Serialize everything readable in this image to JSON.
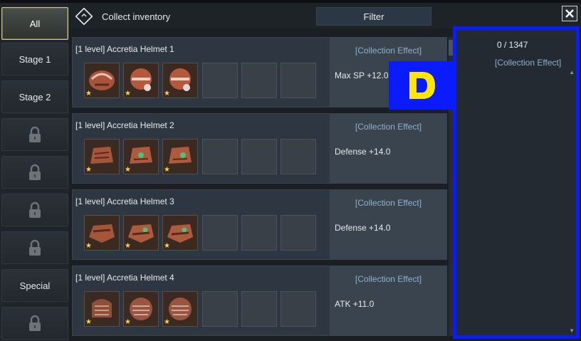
{
  "header": {
    "title": "Collect inventory",
    "filter_label": "Filter"
  },
  "sidebar": {
    "items": [
      {
        "label": "All",
        "active": true,
        "locked": false
      },
      {
        "label": "Stage 1",
        "active": false,
        "locked": false
      },
      {
        "label": "Stage 2",
        "active": false,
        "locked": false
      },
      {
        "label": "",
        "active": false,
        "locked": true
      },
      {
        "label": "",
        "active": false,
        "locked": true
      },
      {
        "label": "",
        "active": false,
        "locked": true
      },
      {
        "label": "",
        "active": false,
        "locked": true
      },
      {
        "label": "Special",
        "active": false,
        "locked": false
      },
      {
        "label": "",
        "active": false,
        "locked": true
      }
    ]
  },
  "collections": [
    {
      "title": "[1 level] Accretia Helmet 1",
      "effect_header": "[Collection Effect]",
      "effect": "Max SP +12.0",
      "filled_slots": 3,
      "total_slots": 6
    },
    {
      "title": "[1 level] Accretia Helmet 2",
      "effect_header": "[Collection Effect]",
      "effect": "Defense +14.0",
      "filled_slots": 3,
      "total_slots": 6
    },
    {
      "title": "[1 level] Accretia Helmet 3",
      "effect_header": "[Collection Effect]",
      "effect": "Defense +14.0",
      "filled_slots": 3,
      "total_slots": 6
    },
    {
      "title": "[1 level] Accretia Helmet 4",
      "effect_header": "[Collection Effect]",
      "effect": "ATK +11.0",
      "filled_slots": 3,
      "total_slots": 6
    }
  ],
  "right_panel": {
    "count": "0 / 1347",
    "effect_header": "[Collection Effect]"
  },
  "badge": {
    "letter": "D"
  },
  "colors": {
    "accent_blue": "#0b1bff",
    "badge_letter": "#ffe600",
    "effect_header": "#8fb0cf",
    "star": "#f3d35b"
  },
  "icons": {
    "logo": "diamond-logo-icon",
    "close": "close-icon",
    "lock": "lock-icon",
    "star": "star-icon",
    "helmet": "helmet-icon"
  }
}
